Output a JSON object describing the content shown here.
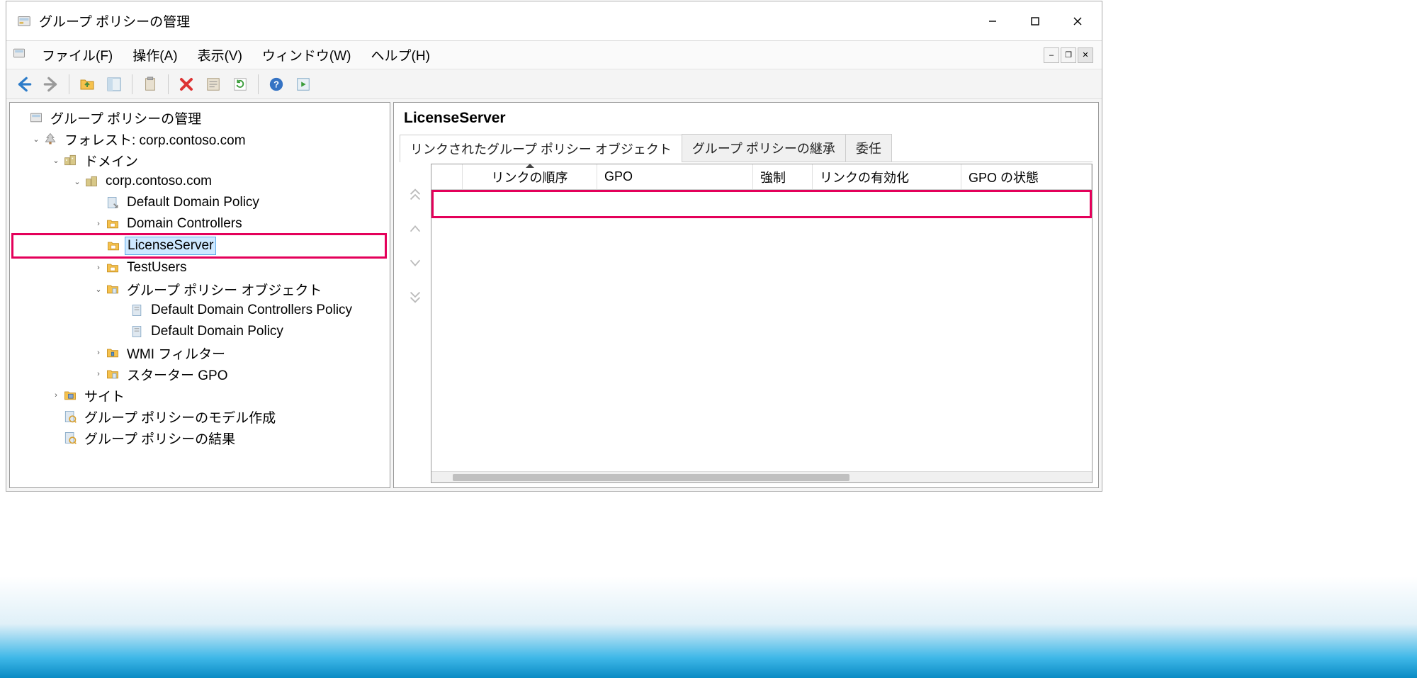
{
  "title": "グループ ポリシーの管理",
  "menu": {
    "file": "ファイル(F)",
    "action": "操作(A)",
    "view": "表示(V)",
    "window": "ウィンドウ(W)",
    "help": "ヘルプ(H)"
  },
  "tree": {
    "root": "グループ ポリシーの管理",
    "forest": "フォレスト: corp.contoso.com",
    "domains": "ドメイン",
    "domain": "corp.contoso.com",
    "default_domain_policy": "Default Domain Policy",
    "domain_controllers": "Domain Controllers",
    "license_server": "LicenseServer",
    "test_users": "TestUsers",
    "gpo_container": "グループ ポリシー オブジェクト",
    "ddcp": "Default Domain Controllers Policy",
    "ddp": "Default Domain Policy",
    "wmi": "WMI フィルター",
    "starter": "スターター GPO",
    "sites": "サイト",
    "modeling": "グループ ポリシーのモデル作成",
    "results": "グループ ポリシーの結果"
  },
  "detail": {
    "heading": "LicenseServer",
    "tabs": {
      "linked": "リンクされたグループ ポリシー オブジェクト",
      "inheritance": "グループ ポリシーの継承",
      "delegation": "委任"
    },
    "columns": {
      "blank": "",
      "link_order": "リンクの順序",
      "gpo": "GPO",
      "enforced": "強制",
      "link_enabled": "リンクの有効化",
      "gpo_status": "GPO の状態"
    }
  }
}
